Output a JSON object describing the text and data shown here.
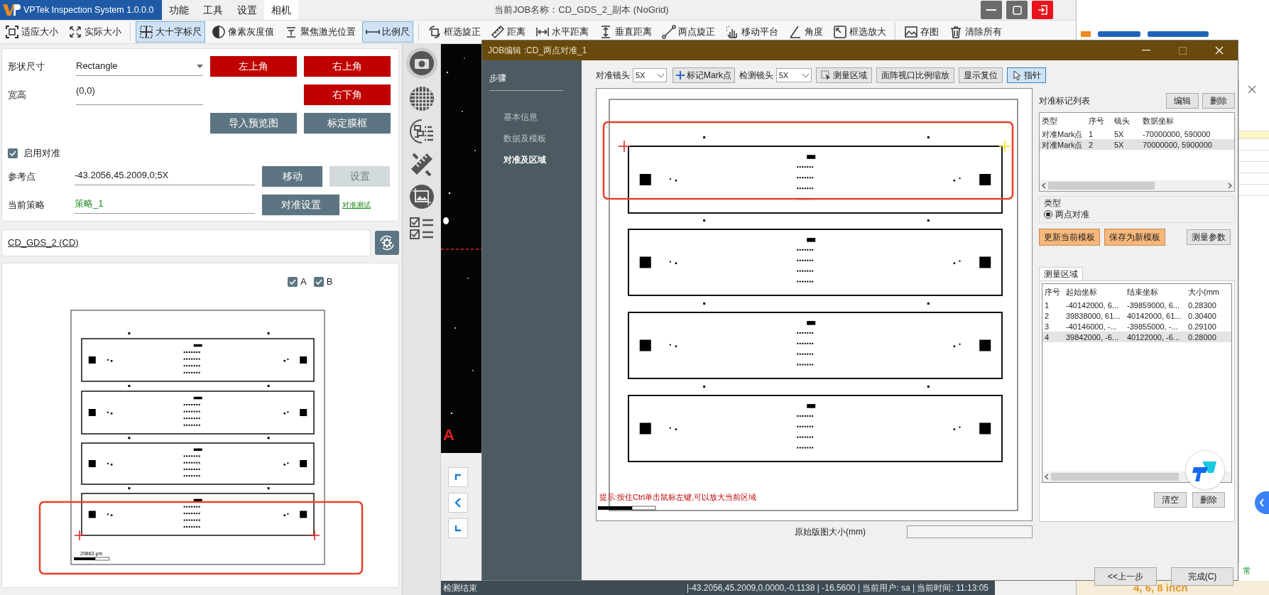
{
  "app": {
    "title": "VPTek Inspection System 1.0.0.0",
    "menu": [
      {
        "label": "功能",
        "selected": false
      },
      {
        "label": "工具",
        "selected": false
      },
      {
        "label": "设置",
        "selected": false
      },
      {
        "label": "相机",
        "selected": true
      }
    ],
    "job_name": "当前JOB名称：CD_GDS_2_副本 (NoGrid)"
  },
  "toolbar": [
    {
      "label": "适应大小",
      "selected": false
    },
    {
      "label": "实际大小",
      "selected": false
    },
    {
      "label": "大十字标尺",
      "selected": true
    },
    {
      "label": "像素灰度值",
      "selected": false
    },
    {
      "label": "聚焦激光位置",
      "selected": false
    },
    {
      "label": "比例尺",
      "selected": true
    },
    {
      "label": "框选旋正",
      "selected": false
    },
    {
      "label": "距离",
      "selected": false
    },
    {
      "label": "水平距离",
      "selected": false
    },
    {
      "label": "垂直距离",
      "selected": false
    },
    {
      "label": "两点旋正",
      "selected": false
    },
    {
      "label": "移动平台",
      "selected": false
    },
    {
      "label": "角度",
      "selected": false
    },
    {
      "label": "框选放大",
      "selected": false
    },
    {
      "label": "存图",
      "selected": false
    },
    {
      "label": "清除所有",
      "selected": false
    }
  ],
  "settings": {
    "shape": {
      "label": "形状尺寸",
      "value": "Rectangle"
    },
    "size": {
      "label": "宽高",
      "value": "(0,0)"
    },
    "corner_buttons": [
      "左上角",
      "右上角",
      "右下角"
    ],
    "import_button": "导入预览图",
    "calibrate_button": "标定膜框",
    "enable_alignment": {
      "label": "启用对准",
      "checked": true
    },
    "reference": {
      "label": "参考点",
      "value": "-43.2056,45.2009,0;5X"
    },
    "move_button": "移动",
    "set_button": {
      "label": "设置",
      "disabled": true
    },
    "strategy": {
      "label": "当前策略",
      "value": "策略_1"
    },
    "align_settings_button": "对准设置",
    "align_test_link": "对准测试"
  },
  "job_file": "CD_GDS_2 (CD)",
  "preview": {
    "layers": [
      {
        "label": "A",
        "checked": true
      },
      {
        "label": "B",
        "checked": true
      }
    ],
    "scale_label": "29863 μm"
  },
  "camera": {
    "marker": "A"
  },
  "status_bar": {
    "message": "检测结束",
    "info": "|-43.2056,45.2009,0.0000,-0.1138 | -16.5600 | 当前用户: sa | 当前时间: 11:13:05"
  },
  "dialog": {
    "title": "JOB编辑 :CD_两点对准_1",
    "steps_heading": "步骤",
    "steps": [
      {
        "label": "基本信息",
        "selected": false
      },
      {
        "label": "数据及模板",
        "selected": false
      },
      {
        "label": "对准及区域",
        "selected": true
      }
    ],
    "align_lens": {
      "label": "对准镜头",
      "value": "5X"
    },
    "mark_button": "标记Mark点",
    "detect_lens": {
      "label": "检测镜头",
      "value": "5X"
    },
    "tools": [
      {
        "label": "测量区域",
        "selected": false
      },
      {
        "label": "面阵视口比例缩放",
        "selected": false
      },
      {
        "label": "显示复位",
        "selected": false
      },
      {
        "label": "指针",
        "selected": true
      }
    ],
    "hint": "提示:按住Ctrl单击鼠标左键,可以放大当前区域",
    "size_label": "原始版图大小(mm)",
    "marks": {
      "title": "对准标记列表",
      "buttons": [
        "编辑",
        "删除"
      ],
      "columns": [
        "类型",
        "序号",
        "镜头",
        "数据坐标"
      ],
      "rows": [
        {
          "cells": [
            "对准Mark点",
            "1",
            "5X",
            "-70000000, 590000"
          ],
          "selected": false
        },
        {
          "cells": [
            "对准Mark点",
            "2",
            "5X",
            "70000000, 5900000"
          ],
          "selected": true
        }
      ]
    },
    "type_group": {
      "label": "类型",
      "options": [
        {
          "label": "两点对准",
          "selected": true
        }
      ]
    },
    "template_buttons": [
      "更新当前模板",
      "保存为新模板"
    ],
    "measure_params_button": "测量参数",
    "measure": {
      "tab": "测量区域",
      "columns": [
        "序号",
        "起始坐标",
        "结束坐标",
        "大小(mm"
      ],
      "rows": [
        {
          "cells": [
            "1",
            "-40142000, 6...",
            "-39859000, 6...",
            "0.28300"
          ],
          "selected": false
        },
        {
          "cells": [
            "2",
            "39838000, 61...",
            "40142000, 61...",
            "0.30400"
          ],
          "selected": false
        },
        {
          "cells": [
            "3",
            "-40146000, -...",
            "-39855000, -...",
            "0.29100"
          ],
          "selected": false
        },
        {
          "cells": [
            "4",
            "39842000, -6...",
            "40122000, -6...",
            "0.28000"
          ],
          "selected": true
        }
      ],
      "buttons": [
        "清空",
        "删除"
      ]
    },
    "nav": [
      "<<上一步",
      "完成(C)"
    ]
  },
  "background": {
    "status": "常",
    "banner": "4, 6, 8 inch"
  }
}
